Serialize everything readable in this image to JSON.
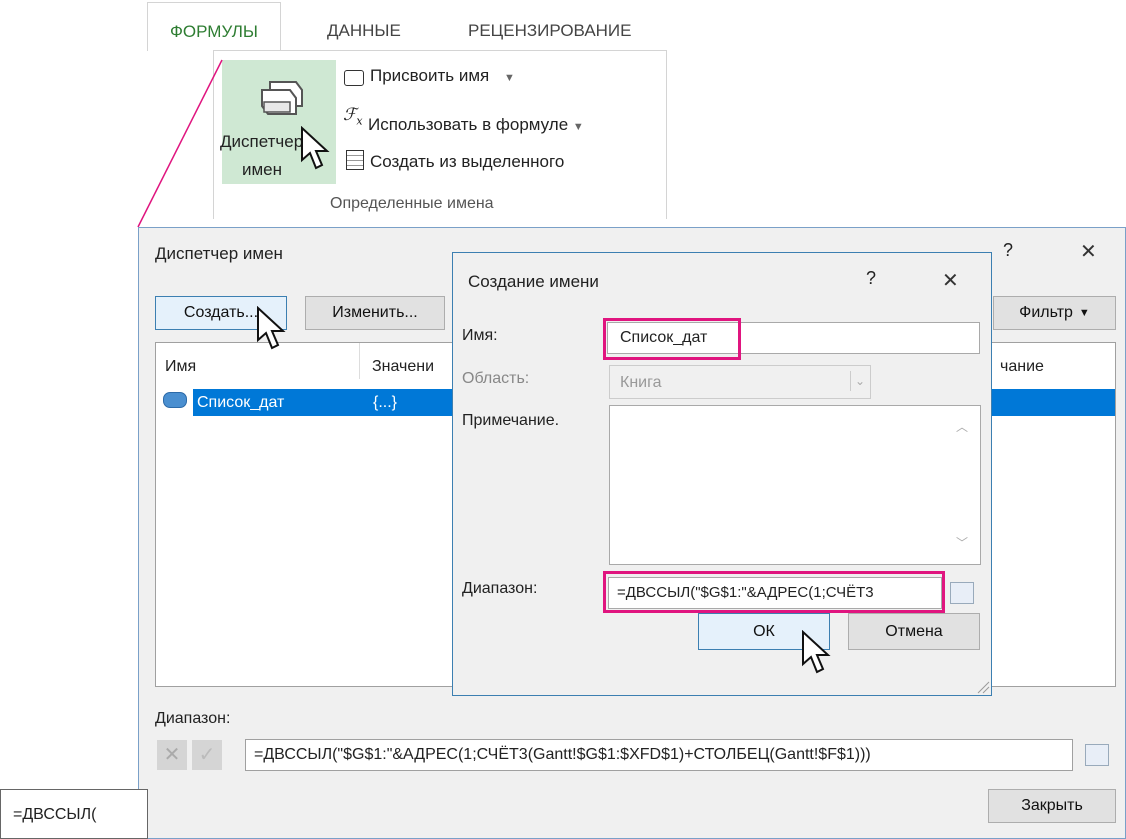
{
  "ribbon": {
    "tabs": [
      "ФОРМУЛЫ",
      "ДАННЫЕ",
      "РЕЦЕНЗИРОВАНИЕ"
    ],
    "name_manager_line1": "Диспетчер",
    "name_manager_line2": "имен",
    "assign_name": "Присвоить имя",
    "use_in_formula": "Использовать в формуле",
    "create_from_selection": "Создать из выделенного",
    "group_label": "Определенные имена",
    "highlight_color": "#cfe8d3",
    "callout_color": "#e0157f"
  },
  "name_manager": {
    "title": "Диспетчер имен",
    "help": "?",
    "close_glyph": "✕",
    "new_label": "Создать...",
    "edit_label": "Изменить...",
    "filter_label": "Фильтр",
    "columns": [
      "Имя",
      "Значени",
      "чание"
    ],
    "row": {
      "name": "Список_дат",
      "value": "{...}"
    },
    "refers_to_label": "Диапазон:",
    "refers_to_value": "=ДВССЫЛ(\"$G$1:\"&АДРЕС(1;СЧЁТ3(Gantt!$G$1:$XFD$1)+СТОЛБЕЦ(Gantt!$F$1)))",
    "close_label": "Закрыть"
  },
  "new_name": {
    "title": "Создание имени",
    "help": "?",
    "close_glyph": "✕",
    "name_label": "Имя:",
    "name_value": "Список_дат",
    "scope_label": "Область:",
    "scope_value": "Книга",
    "comment_label": "Примечание.",
    "refers_to_label": "Диапазон:",
    "refers_to_value": "=ДВССЫЛ(\"$G$1:\"&АДРЕС(1;СЧЁТ3",
    "ok_label": "ОК",
    "cancel_label": "Отмена"
  },
  "formula_cell": {
    "value": "=ДВССЫЛ("
  }
}
